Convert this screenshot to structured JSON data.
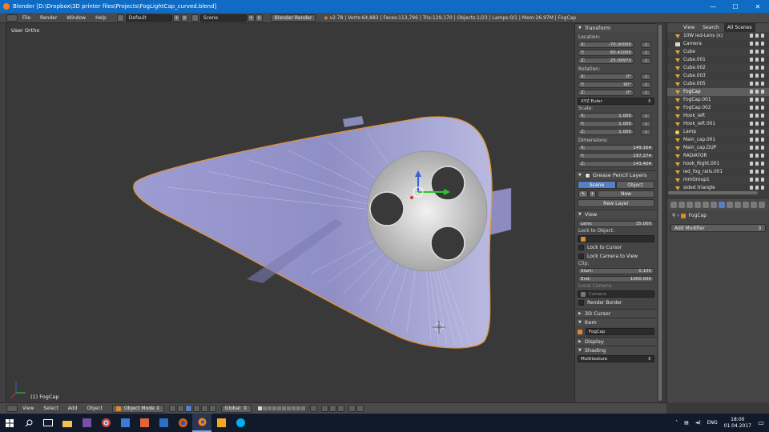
{
  "titlebar": {
    "title": "Blender [D:\\Dropbox\\3D printer files\\Projects\\FogLightCap_curved.blend]",
    "minimize": "—",
    "maximize": "☐",
    "close": "✕"
  },
  "infobar": {
    "menus": [
      "File",
      "Render",
      "Window",
      "Help"
    ],
    "screen_layout": "Default",
    "scene": "Scene",
    "render_engine": "Blender Render",
    "stats": "v2.78 | Verts:64,883 | Faces:113,796 | Tris:129,170 | Objects:1/23 | Lamps:0/1 | Mem:26.97M | FogCap"
  },
  "viewport": {
    "view_label": "User Ortho",
    "object_label": "(1) FogCap"
  },
  "transform_panel": {
    "title": "Transform",
    "location_label": "Location:",
    "location": [
      {
        "axis": "X:",
        "value": "-70.00000"
      },
      {
        "axis": "Y:",
        "value": "60.41000"
      },
      {
        "axis": "Z:",
        "value": "25.09970"
      }
    ],
    "rotation_label": "Rotation:",
    "rotation": [
      {
        "axis": "X:",
        "value": "0°"
      },
      {
        "axis": "Y:",
        "value": "90°"
      },
      {
        "axis": "Z:",
        "value": "0°"
      }
    ],
    "rotation_mode": "XYZ Euler",
    "scale_label": "Scale:",
    "scale": [
      {
        "axis": "X:",
        "value": "1.000"
      },
      {
        "axis": "Y:",
        "value": "1.000"
      },
      {
        "axis": "Z:",
        "value": "1.000"
      }
    ],
    "dimensions_label": "Dimensions:",
    "dimensions": [
      {
        "axis": "X:",
        "value": "149.164"
      },
      {
        "axis": "Y:",
        "value": "197.274"
      },
      {
        "axis": "Z:",
        "value": "143.404"
      }
    ]
  },
  "grease_pencil": {
    "title": "Grease Pencil Layers",
    "tab_scene": "Scene",
    "tab_object": "Object",
    "new_label": "New",
    "new_layer_label": "New Layer"
  },
  "view_panel": {
    "title": "View",
    "lens_label": "Lens:",
    "lens_value": "35.000",
    "lock_to_object_label": "Lock to Object:",
    "lock_to_cursor": "Lock to Cursor",
    "lock_camera_to_view": "Lock Camera to View",
    "clip_label": "Clip:",
    "clip_start_label": "Start:",
    "clip_start": "0.100",
    "clip_end_label": "End:",
    "clip_end": "1000.000",
    "local_camera_label": "Local Camera:",
    "local_camera_value": "Camera",
    "render_border": "Render Border"
  },
  "collapsed_panels": {
    "cursor": "3D Cursor",
    "item": "Item",
    "item_name": "FogCap",
    "display": "Display",
    "shading": "Shading",
    "shading_mode": "Multitexture"
  },
  "outliner": {
    "tabs": [
      "View",
      "Search",
      "All Scenes"
    ],
    "items": [
      {
        "name": "10W led-Lens (x)",
        "icon": "mesh",
        "selected": false
      },
      {
        "name": "Camera",
        "icon": "camera",
        "selected": false
      },
      {
        "name": "Cube",
        "icon": "mesh",
        "selected": false
      },
      {
        "name": "Cube.001",
        "icon": "mesh",
        "selected": false
      },
      {
        "name": "Cube.002",
        "icon": "mesh",
        "selected": false
      },
      {
        "name": "Cube.003",
        "icon": "mesh",
        "selected": false
      },
      {
        "name": "Cube.005",
        "icon": "mesh",
        "selected": false
      },
      {
        "name": "FogCap",
        "icon": "mesh",
        "selected": true
      },
      {
        "name": "FogCap.001",
        "icon": "mesh",
        "selected": false
      },
      {
        "name": "FogCap.002",
        "icon": "mesh",
        "selected": false
      },
      {
        "name": "Hook_left",
        "icon": "mesh",
        "selected": false
      },
      {
        "name": "Hook_left.001",
        "icon": "mesh",
        "selected": false
      },
      {
        "name": "Lamp",
        "icon": "lamp",
        "selected": false
      },
      {
        "name": "Main_cap.001",
        "icon": "mesh",
        "selected": false
      },
      {
        "name": "Main_cap.DUP",
        "icon": "mesh",
        "selected": false
      },
      {
        "name": "RADIATOR",
        "icon": "mesh",
        "selected": false
      },
      {
        "name": "hook_Right.001",
        "icon": "mesh",
        "selected": false
      },
      {
        "name": "led_fog_rails.001",
        "icon": "mesh",
        "selected": false
      },
      {
        "name": "mmGroup1",
        "icon": "mesh",
        "selected": false
      },
      {
        "name": "sided triangle",
        "icon": "mesh",
        "selected": false
      }
    ]
  },
  "modifier_props": {
    "context_name": "FogCap",
    "add_modifier": "Add Modifier"
  },
  "view_header": {
    "menus": [
      "View",
      "Select",
      "Add",
      "Object"
    ],
    "mode": "Object Mode",
    "orientation": "Global"
  },
  "taskbar": {
    "language": "ENG",
    "time": "18:00",
    "date": "01.04.2017"
  },
  "colors": {
    "selection_outline": "#e8932f",
    "mesh_fill": "#a7a7d9",
    "accent_blue": "#5680c2"
  }
}
